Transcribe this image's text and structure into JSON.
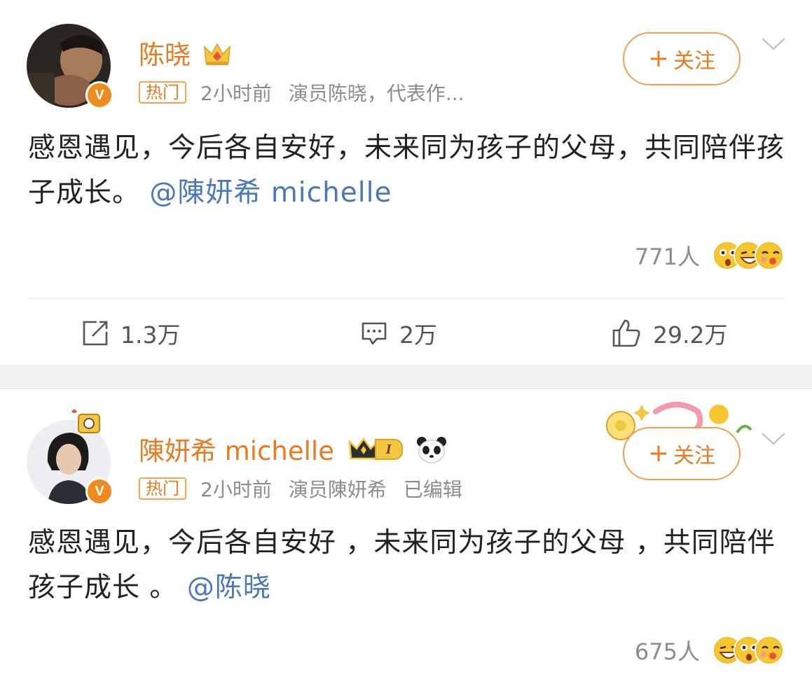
{
  "posts": [
    {
      "user_name": "陈晓",
      "hot_label": "热门",
      "time": "2小时前",
      "description": "演员陈晓，代表作...",
      "follow_label": "关注",
      "content_text": "感恩遇见，今后各自安好，未来同为孩子的父母，共同陪伴孩子成长。",
      "mention": "@陳妍希 michelle",
      "reaction_count": "771人",
      "reactions": [
        "surprised-emoji",
        "laugh-emoji",
        "kiss-emoji"
      ],
      "repost_count": "1.3万",
      "comment_count": "2万",
      "like_count": "29.2万",
      "icons": {
        "verified": "verified-v-icon",
        "crown": "crown-icon"
      }
    },
    {
      "user_name": "陳妍希 michelle",
      "hot_label": "热门",
      "time": "2小时前",
      "description": "演员陳妍希",
      "edited_label": "已编辑",
      "follow_label": "关注",
      "content_text": "感恩遇见，今后各自安好 ，未来同为孩子的父母 ，共同陪伴孩子成长 。",
      "mention": "@陈晓",
      "reaction_count": "675人",
      "reactions": [
        "laugh-emoji",
        "surprised-emoji",
        "kiss-emoji"
      ],
      "level_badge_text": "I",
      "icons": {
        "verified": "verified-v-icon",
        "crown": "crown-level-icon",
        "panda": "panda-icon"
      }
    }
  ],
  "colors": {
    "accent_orange": "#e87b20",
    "mention_blue": "#4a78b8",
    "meta_gray": "#8c8c8c",
    "divider": "#f2f2f2"
  }
}
